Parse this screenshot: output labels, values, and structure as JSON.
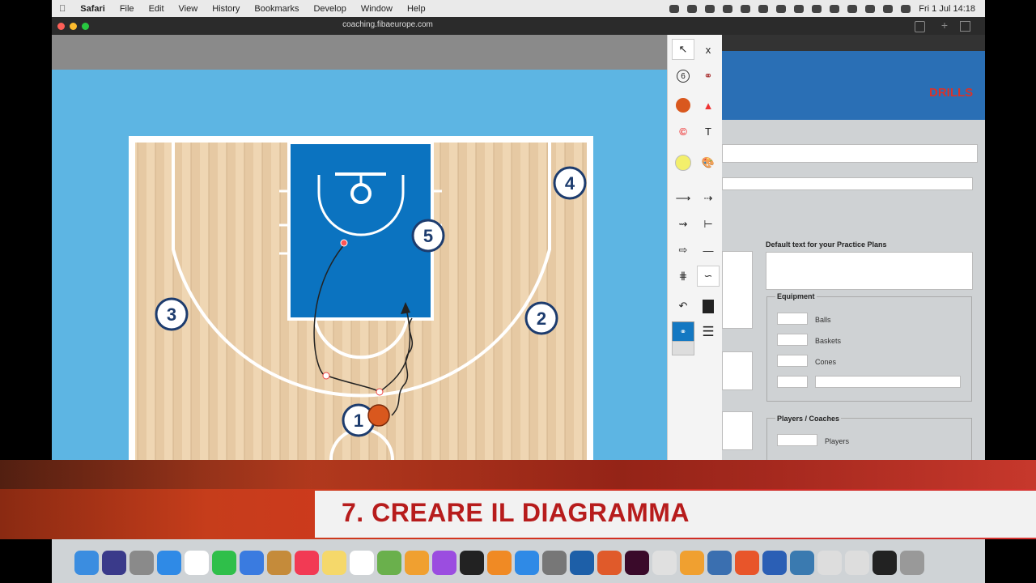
{
  "menubar": {
    "app": "Safari",
    "items": [
      "File",
      "Edit",
      "View",
      "History",
      "Bookmarks",
      "Develop",
      "Window",
      "Help"
    ],
    "clock": "Fri 1 Jul  14:18"
  },
  "browser": {
    "url": "coaching.fibaeurope.com"
  },
  "court": {
    "players": [
      "1",
      "2",
      "3",
      "4",
      "5"
    ]
  },
  "tools": {
    "select_label": "↖",
    "close_label": "x",
    "number_six": "6",
    "text_label": "T",
    "copyright_label": "©"
  },
  "right_page": {
    "logo_text": "DRILLS",
    "default_text_label": "Default text for your Practice Plans",
    "equipment_title": "Equipment",
    "equipment_items": [
      "Balls",
      "Baskets",
      "Cones"
    ],
    "players_title": "Players / Coaches",
    "players_items": [
      "Players"
    ]
  },
  "banner": {
    "title": "7. CREARE IL DIAGRAMMA"
  },
  "dock": {
    "icons": [
      "finder-icon",
      "siri-icon",
      "launchpad-icon",
      "safari-icon",
      "calendar-icon",
      "facetime-icon",
      "mail-icon",
      "contacts-icon",
      "music-icon",
      "notes-icon",
      "reminders-icon",
      "maps-icon",
      "photos-icon",
      "podcasts-icon",
      "tv-icon",
      "books-icon",
      "appstore-icon",
      "preferences-icon",
      "fibadrill-icon",
      "rocket-icon",
      "indesign-icon",
      "chrome-icon",
      "pencil-icon",
      "screensnap-icon",
      "slides-icon",
      "word-icon",
      "network-icon",
      "folder-icon",
      "folder-icon-2",
      "app-icon",
      "trash-icon"
    ]
  }
}
